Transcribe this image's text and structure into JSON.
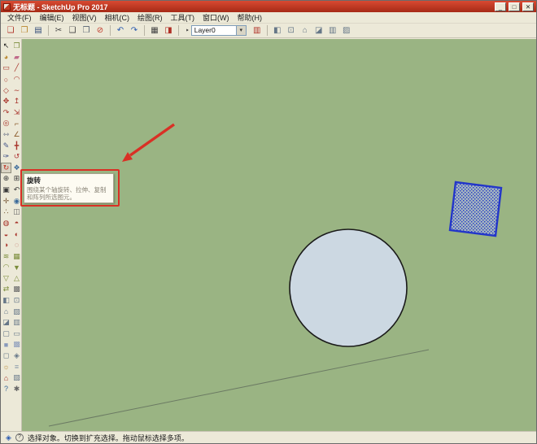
{
  "window": {
    "title": "无标题 - SketchUp Pro 2017",
    "controls": {
      "minimize": "_",
      "maximize": "□",
      "close": "✕"
    }
  },
  "menu": {
    "items": [
      "文件(F)",
      "编辑(E)",
      "视图(V)",
      "相机(C)",
      "绘图(R)",
      "工具(T)",
      "窗口(W)",
      "帮助(H)"
    ]
  },
  "toolbar": {
    "items_left": [
      {
        "name": "new-icon",
        "glyph": "❏",
        "color": "#b03026",
        "inter": "true"
      },
      {
        "name": "open-icon",
        "glyph": "❐",
        "color": "#b8862d",
        "inter": "true"
      },
      {
        "name": "save-icon",
        "glyph": "▤",
        "color": "#334d7a",
        "inter": "true"
      },
      {
        "name": "toolbar-separator",
        "glyph": "",
        "inter": "false"
      },
      {
        "name": "cut-icon",
        "glyph": "✂",
        "color": "#444444",
        "inter": "true"
      },
      {
        "name": "copy-icon",
        "glyph": "❑",
        "color": "#444444",
        "inter": "true"
      },
      {
        "name": "paste-icon",
        "glyph": "❒",
        "color": "#556070",
        "inter": "true"
      },
      {
        "name": "erase-icon",
        "glyph": "⊘",
        "color": "#c03a2a",
        "inter": "true"
      },
      {
        "name": "toolbar-separator",
        "glyph": "",
        "inter": "false"
      },
      {
        "name": "undo-icon",
        "glyph": "↶",
        "color": "#2a5ab0",
        "inter": "true"
      },
      {
        "name": "redo-icon",
        "glyph": "↷",
        "color": "#2a5ab0",
        "inter": "true"
      },
      {
        "name": "toolbar-separator",
        "glyph": "",
        "inter": "false"
      },
      {
        "name": "print-icon",
        "glyph": "▦",
        "color": "#444444",
        "inter": "true"
      },
      {
        "name": "model-info-icon",
        "glyph": "◨",
        "color": "#b03026",
        "inter": "true"
      },
      {
        "name": "toolbar-separator",
        "glyph": "",
        "inter": "false"
      }
    ],
    "layer": {
      "marker": "‣",
      "value": "Layer0",
      "dropdown_glyph": "▾"
    },
    "items_right": [
      {
        "name": "layer-manager-icon",
        "glyph": "▥",
        "color": "#b03026",
        "inter": "true"
      },
      {
        "name": "toolbar-separator",
        "glyph": "",
        "inter": "false"
      },
      {
        "name": "iso-view-icon",
        "glyph": "◧",
        "color": "#667788",
        "inter": "true"
      },
      {
        "name": "top-view-icon",
        "glyph": "⊡",
        "color": "#667788",
        "inter": "true"
      },
      {
        "name": "front-view-icon",
        "glyph": "⌂",
        "color": "#667788",
        "inter": "true"
      },
      {
        "name": "back-view-icon",
        "glyph": "◪",
        "color": "#667788",
        "inter": "true"
      },
      {
        "name": "left-view-icon",
        "glyph": "▥",
        "color": "#667788",
        "inter": "true"
      },
      {
        "name": "right-view-icon",
        "glyph": "▨",
        "color": "#667788",
        "inter": "true"
      }
    ]
  },
  "palette": {
    "items": [
      {
        "name": "select-tool",
        "glyph": "↖",
        "color": "#1a1a1a"
      },
      {
        "name": "make-component-tool",
        "glyph": "❐",
        "color": "#7a8c3a"
      },
      {
        "name": "paint-bucket-tool",
        "glyph": "◕",
        "color": "#b8862d"
      },
      {
        "name": "eraser-tool",
        "glyph": "▰",
        "color": "#c06a8a"
      },
      {
        "name": "rectangle-tool",
        "glyph": "▭",
        "color": "#a8352c"
      },
      {
        "name": "line-tool",
        "glyph": "╱",
        "color": "#a8352c"
      },
      {
        "name": "circle-tool",
        "glyph": "○",
        "color": "#a8352c"
      },
      {
        "name": "arc-tool",
        "glyph": "◠",
        "color": "#a8352c"
      },
      {
        "name": "polygon-tool",
        "glyph": "◇",
        "color": "#a8352c"
      },
      {
        "name": "freehand-tool",
        "glyph": "∼",
        "color": "#a8352c"
      },
      {
        "name": "move-tool",
        "glyph": "✥",
        "color": "#a8352c"
      },
      {
        "name": "push-pull-tool",
        "glyph": "↥",
        "color": "#a8352c"
      },
      {
        "name": "follow-me-tool",
        "glyph": "↷",
        "color": "#a8352c"
      },
      {
        "name": "scale-tool",
        "glyph": "⇲",
        "color": "#a8352c"
      },
      {
        "name": "offset-tool",
        "glyph": "◎",
        "color": "#a8352c"
      },
      {
        "name": "tape-measure-tool",
        "glyph": "⌐",
        "color": "#8a5a2a"
      },
      {
        "name": "dimension-tool",
        "glyph": "⇿",
        "color": "#55607a"
      },
      {
        "name": "protractor-tool",
        "glyph": "∠",
        "color": "#8a5a2a"
      },
      {
        "name": "text-tool",
        "glyph": "✎",
        "color": "#44558a"
      },
      {
        "name": "axes-tool",
        "glyph": "╋",
        "color": "#a8352c"
      },
      {
        "name": "3d-text-tool",
        "glyph": "✑",
        "color": "#44558a"
      },
      {
        "name": "orbit-tool",
        "glyph": "↺",
        "color": "#b03a3a"
      },
      {
        "name": "rotate-tool",
        "glyph": "↻",
        "color": "#c03020",
        "state": "active"
      },
      {
        "name": "pan-tool",
        "glyph": "❖",
        "color": "#3a6a9a"
      },
      {
        "name": "zoom-tool",
        "glyph": "⊕",
        "color": "#3a3a3a"
      },
      {
        "name": "zoom-extents-tool",
        "glyph": "⊞",
        "color": "#3a3a3a"
      },
      {
        "name": "zoom-window-tool",
        "glyph": "▣",
        "color": "#3a3a3a"
      },
      {
        "name": "zoom-previous-tool",
        "glyph": "↶",
        "color": "#3a3a3a"
      },
      {
        "name": "position-camera-tool",
        "glyph": "✛",
        "color": "#7a5a3a"
      },
      {
        "name": "look-around-tool",
        "glyph": "◉",
        "color": "#3a6a9a"
      },
      {
        "name": "walk-tool",
        "glyph": "∴",
        "color": "#7a5a3a"
      },
      {
        "name": "section-plane-tool",
        "glyph": "◫",
        "color": "#666666"
      },
      {
        "name": "outer-shell-tool",
        "glyph": "◍",
        "color": "#a8352c"
      },
      {
        "name": "union-tool",
        "glyph": "◓",
        "color": "#a8352c"
      },
      {
        "name": "subtract-tool",
        "glyph": "◒",
        "color": "#a8352c"
      },
      {
        "name": "trim-tool",
        "glyph": "◐",
        "color": "#a8352c"
      },
      {
        "name": "intersect-tool",
        "glyph": "◑",
        "color": "#a8352c"
      },
      {
        "name": "split-tool",
        "glyph": "◌",
        "color": "#a8352c"
      },
      {
        "name": "from-contours-tool",
        "glyph": "≋",
        "color": "#7a8c3a"
      },
      {
        "name": "from-scratch-tool",
        "glyph": "▦",
        "color": "#7a8c3a"
      },
      {
        "name": "smoove-tool",
        "glyph": "◠",
        "color": "#7a8c3a"
      },
      {
        "name": "stamp-tool",
        "glyph": "▼",
        "color": "#7a8c3a"
      },
      {
        "name": "drape-tool",
        "glyph": "▽",
        "color": "#7a8c3a"
      },
      {
        "name": "add-detail-tool",
        "glyph": "△",
        "color": "#7a8c3a"
      },
      {
        "name": "flip-edge-tool",
        "glyph": "⇄",
        "color": "#7a8c3a"
      },
      {
        "name": "section-fill-tool",
        "glyph": "▩",
        "color": "#666666"
      },
      {
        "name": "iso-view-tool",
        "glyph": "◧",
        "color": "#667788"
      },
      {
        "name": "top-view-tool",
        "glyph": "⊡",
        "color": "#667788"
      },
      {
        "name": "front-view-tool",
        "glyph": "⌂",
        "color": "#667788"
      },
      {
        "name": "right-view-tool",
        "glyph": "▨",
        "color": "#667788"
      },
      {
        "name": "back-view-tool",
        "glyph": "◪",
        "color": "#667788"
      },
      {
        "name": "left-view-tool",
        "glyph": "▥",
        "color": "#667788"
      },
      {
        "name": "wireframe-style-tool",
        "glyph": "▢",
        "color": "#667788"
      },
      {
        "name": "hidden-line-style-tool",
        "glyph": "▭",
        "color": "#667788"
      },
      {
        "name": "shaded-style-tool",
        "glyph": "■",
        "color": "#8899bb"
      },
      {
        "name": "textured-style-tool",
        "glyph": "▩",
        "color": "#8899bb"
      },
      {
        "name": "monochrome-style-tool",
        "glyph": "◻",
        "color": "#667788"
      },
      {
        "name": "x-ray-style-tool",
        "glyph": "◈",
        "color": "#667788"
      },
      {
        "name": "shadows-tool",
        "glyph": "☼",
        "color": "#b8862d"
      },
      {
        "name": "fog-tool",
        "glyph": "≡",
        "color": "#8899aa"
      },
      {
        "name": "warehouse-tool",
        "glyph": "⌂",
        "color": "#a8352c"
      },
      {
        "name": "match-photo-tool",
        "glyph": "▧",
        "color": "#667788"
      },
      {
        "name": "help-tool",
        "glyph": "?",
        "color": "#3a6a9a"
      },
      {
        "name": "preferences-tool",
        "glyph": "✱",
        "color": "#666666"
      }
    ]
  },
  "annotation": {
    "tooltip_title": "旋转",
    "tooltip_desc": "围绕某个轴旋转、拉伸、复制和阵列所选图元。",
    "arrow_color": "#d93025"
  },
  "status": {
    "geo_glyph": "◈",
    "help_glyph": "?",
    "text": "选择对象。切换到扩充选择。拖动鼠标选择多项。"
  },
  "colors": {
    "canvas": "#9ab483",
    "circle_fill": "#ccd8e2",
    "circle_stroke": "#1a1a1a",
    "selection_stroke": "#2336c9",
    "selection_fill": "#a9b6de",
    "edge": "#6b7a63"
  }
}
